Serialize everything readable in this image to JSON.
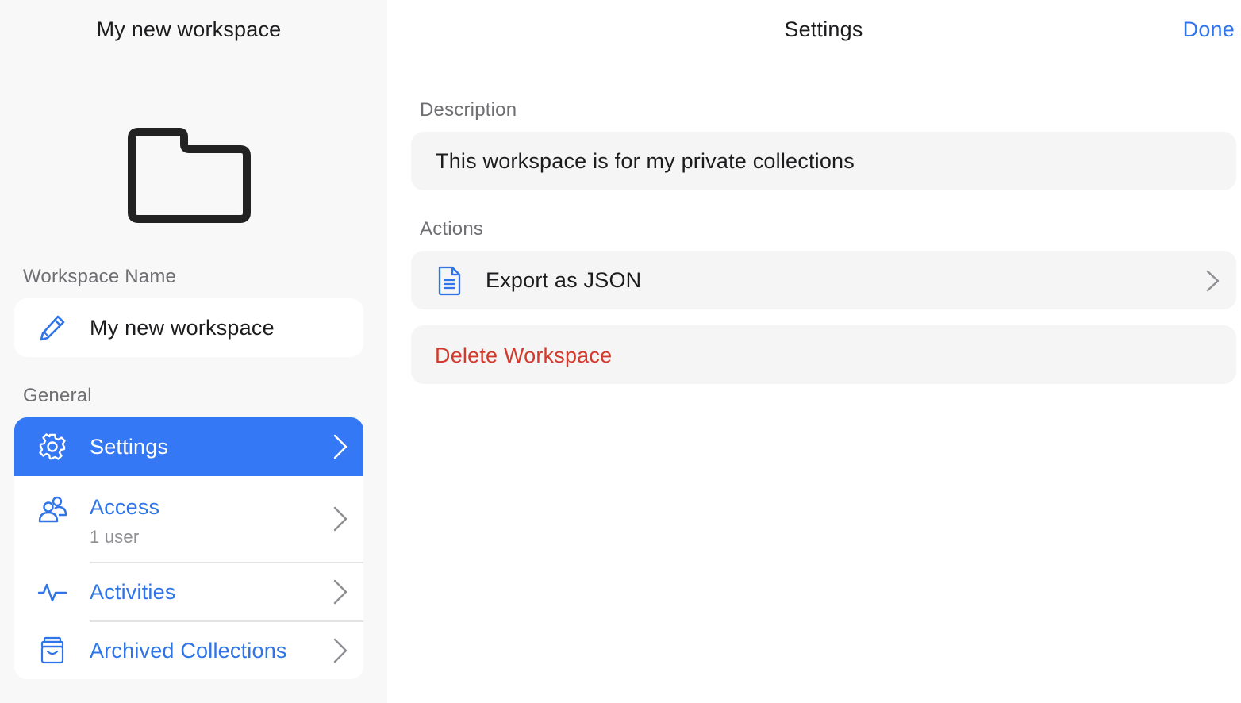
{
  "sidebar": {
    "title": "My new workspace",
    "folder_icon": "folder-icon",
    "workspace_name_label": "Workspace Name",
    "workspace_name_value": "My new workspace",
    "general_label": "General",
    "items": [
      {
        "label": "Settings",
        "icon": "gear-icon",
        "selected": true
      },
      {
        "label": "Access",
        "sublabel": "1 user",
        "icon": "people-icon"
      },
      {
        "label": "Activities",
        "icon": "activity-icon"
      },
      {
        "label": "Archived Collections",
        "icon": "archive-box-icon"
      }
    ]
  },
  "detail": {
    "title": "Settings",
    "done_label": "Done",
    "description_label": "Description",
    "description_value": "This workspace is for my private collections",
    "actions_label": "Actions",
    "export_label": "Export as JSON",
    "delete_label": "Delete Workspace"
  },
  "colors": {
    "accent": "#3478f6",
    "link": "#2f74e9",
    "danger": "#d33a2c",
    "sidebar_bg": "#f8f8f8"
  }
}
